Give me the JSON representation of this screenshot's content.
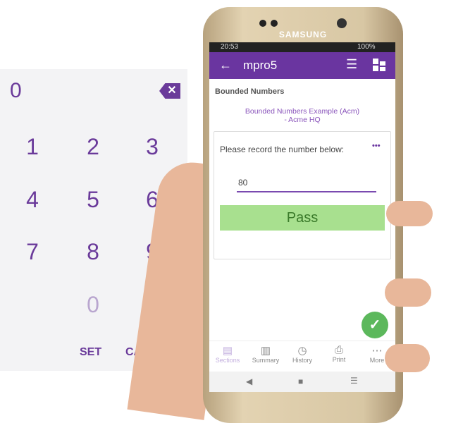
{
  "keypad": {
    "display": "0",
    "keys": [
      "1",
      "2",
      "3",
      "4",
      "5",
      "6",
      "7",
      "8",
      "9",
      "0"
    ],
    "set": "SET",
    "cancel": "CA"
  },
  "phone": {
    "brand": "SAMSUNG",
    "status": {
      "time": "20:53",
      "battery": "100%"
    },
    "header": {
      "title": "mpro5"
    },
    "section_title": "Bounded Numbers",
    "form_title": "Bounded Numbers Example (Acm) - Acme HQ",
    "question": "Please record the number below:",
    "more": "•••",
    "value": "80",
    "result": "Pass",
    "nav": [
      {
        "label": "Sections",
        "icon": "sections-icon"
      },
      {
        "label": "Summary",
        "icon": "summary-icon"
      },
      {
        "label": "History",
        "icon": "clock-icon"
      },
      {
        "label": "Print",
        "icon": "print-icon"
      },
      {
        "label": "More",
        "icon": "more-icon"
      }
    ]
  },
  "colors": {
    "accent": "#6a35a0",
    "pass": "#a8e08f",
    "fab": "#5cb85c"
  }
}
